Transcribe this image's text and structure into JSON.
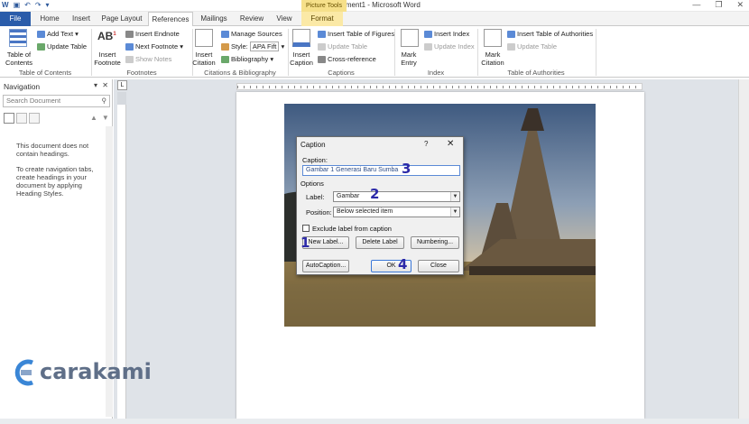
{
  "window": {
    "title": "Document1 - Microsoft Word",
    "contextual_tab_group": "Picture Tools"
  },
  "tabs": [
    "File",
    "Home",
    "Insert",
    "Page Layout",
    "References",
    "Mailings",
    "Review",
    "View",
    "Format"
  ],
  "active_tab": "References",
  "ribbon": {
    "toc": {
      "table_of_contents": "Table of Contents",
      "add_text": "Add Text",
      "update_table": "Update Table",
      "group": "Table of Contents"
    },
    "footnotes": {
      "insert_footnote": "Insert Footnote",
      "insert_endnote": "Insert Endnote",
      "next_footnote": "Next Footnote",
      "show_notes": "Show Notes",
      "group": "Footnotes"
    },
    "citations": {
      "insert_citation": "Insert Citation",
      "manage_sources": "Manage Sources",
      "style_label": "Style:",
      "style_value": "APA Fift",
      "bibliography": "Bibliography",
      "group": "Citations & Bibliography"
    },
    "captions": {
      "insert_caption": "Insert Caption",
      "insert_tof": "Insert Table of Figures",
      "update_table": "Update Table",
      "cross_reference": "Cross-reference",
      "group": "Captions"
    },
    "index": {
      "mark_entry": "Mark Entry",
      "insert_index": "Insert Index",
      "update_index": "Update Index",
      "group": "Index"
    },
    "toa": {
      "mark_citation": "Mark Citation",
      "insert_toa": "Insert Table of Authorities",
      "update_table": "Update Table",
      "group": "Table of Authorities"
    }
  },
  "navigation": {
    "title": "Navigation",
    "search_placeholder": "Search Document",
    "message_1": "This document does not contain headings.",
    "message_2": "To create navigation tabs, create headings in your document by applying Heading Styles."
  },
  "ruler_button": "L",
  "dialog": {
    "title": "Caption",
    "help": "?",
    "caption_label": "Caption:",
    "caption_value": "Gambar 1 Generasi Baru Sumba",
    "options_label": "Options",
    "label_label": "Label:",
    "label_value": "Gambar",
    "position_label": "Position:",
    "position_value": "Below selected item",
    "exclude_label": "Exclude label from caption",
    "new_label_button": "New Label...",
    "delete_label_button": "Delete Label",
    "numbering_button": "Numbering...",
    "autocaption_button": "AutoCaption...",
    "ok_button": "OK",
    "close_button": "Close"
  },
  "step_markers": [
    "1",
    "2",
    "3",
    "4"
  ],
  "watermark": {
    "text": "carakami"
  },
  "colors": {
    "file_tab": "#2a5caa",
    "accent_numbers": "#2c2aa8",
    "context_tab": "#f6e08a",
    "brand": "#5f6f88"
  }
}
